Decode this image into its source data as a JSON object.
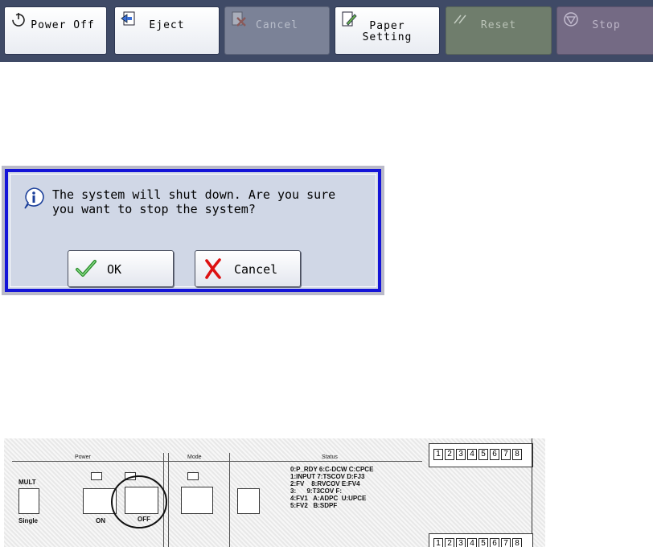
{
  "toolbar": {
    "buttons": [
      {
        "id": "power-off",
        "label": "Power Off",
        "state": "active",
        "icon": "power-icon"
      },
      {
        "id": "eject",
        "label": "Eject",
        "state": "active",
        "icon": "eject-icon"
      },
      {
        "id": "cancel",
        "label": "Cancel",
        "state": "disabled",
        "icon": "cancel-job-icon"
      },
      {
        "id": "paper-setting",
        "label": "Paper\nSetting",
        "state": "active",
        "icon": "paper-setting-icon"
      },
      {
        "id": "reset",
        "label": "Reset",
        "state": "disabled",
        "icon": "reset-icon"
      },
      {
        "id": "stop",
        "label": "Stop",
        "state": "disabled",
        "icon": "stop-icon"
      }
    ]
  },
  "dialog": {
    "message": "The system will shut down. Are you sure\nyou want to stop the system?",
    "ok_label": "OK",
    "cancel_label": "Cancel",
    "icon": "info-icon"
  },
  "panel": {
    "power_header": "Power",
    "mode_header": "Mode",
    "status_header": "Status",
    "left_label": "MULT",
    "single_label": "Single",
    "on_label": "ON",
    "off_label": "OFF",
    "status_lines": "0:P_RDY 6:C-DCW C:CPCE\n1:INPUT 7:TSCOV D:FJ3\n2:FV    8:RVCOV E:FV4\n3:      9:T3COV F:\n4:FV1   A:ADPC  U:UPCE\n5:FV2   B:SDPF",
    "numbers": [
      "1",
      "2",
      "3",
      "4",
      "5",
      "6",
      "7",
      "8"
    ],
    "bottom_numbers": [
      "1",
      "2",
      "3",
      "4",
      "5",
      "6",
      "7",
      "8"
    ]
  }
}
